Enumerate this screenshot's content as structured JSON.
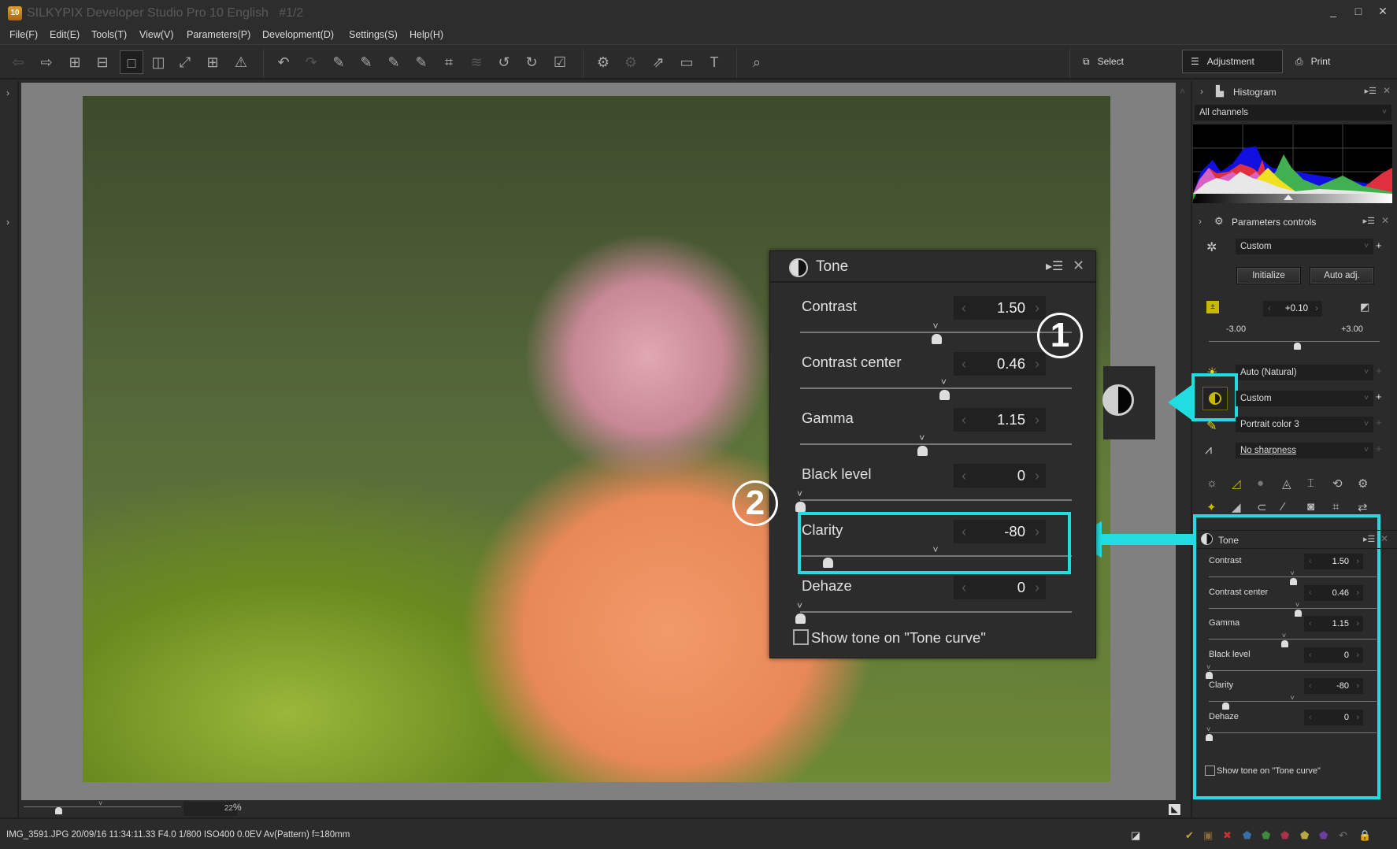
{
  "window": {
    "app_badge": "10",
    "title": "SILKYPIX Developer Studio Pro 10 English",
    "page_indicator": "#1/2",
    "minimize": "_",
    "maximize": "□",
    "close": "✕"
  },
  "menu": [
    "File(F)",
    "Edit(E)",
    "Tools(T)",
    "View(V)",
    "Parameters(P)",
    "Development(D)",
    "Settings(S)",
    "Help(H)"
  ],
  "toolbar": {
    "icons": [
      "previous-image-icon",
      "next-image-icon",
      "thumbnail-grid-icon",
      "filmstrip-icon",
      "single-view-icon",
      "compare-view-icon",
      "fullscreen-icon",
      "fit-view-icon",
      "warning-icon",
      "undo-icon",
      "redo-icon",
      "grey-point-eyedropper-icon",
      "white-balance-eyedropper-icon",
      "black-point-eyedropper-icon",
      "film-eyedropper-icon",
      "transform-icon",
      "layers-icon",
      "rotate-left-icon",
      "rotate-right-icon",
      "mark-checked-icon",
      "save-parameters-icon",
      "apply-parameters-icon",
      "export-icon",
      "display-icon",
      "hammer-icon",
      "loupe-icon"
    ],
    "modes": {
      "select": "Select",
      "adjustment": "Adjustment",
      "print": "Print"
    }
  },
  "canvas": {
    "zoom_value": "22",
    "zoom_unit": "%"
  },
  "status": {
    "info": "IMG_3591.JPG 20/09/16 11:34:11.33 F4.0 1/800 ISO400  0.0EV Av(Pattern) f=180mm",
    "mark_colors": [
      "#c9a437",
      "#8a6b3c",
      "#c83232",
      "#3a6ea8",
      "#3f8a3f",
      "#a8324a",
      "#b8a840",
      "#6a3fa0"
    ]
  },
  "right_panel": {
    "histogram": {
      "title": "Histogram",
      "channel": "All channels"
    },
    "parameters": {
      "title": "Parameters controls",
      "preset": "Custom",
      "initialize": "Initialize",
      "auto_adj": "Auto adj.",
      "exposure_value": "+0.10",
      "exposure_min": "-3.00",
      "exposure_max": "+3.00",
      "exposure_level": 0.517,
      "white_balance": "Auto (Natural)",
      "tone": "Custom",
      "color": "Portrait color 3",
      "sharpness": "No sharpness"
    },
    "tone": {
      "title": "Tone",
      "rows": [
        {
          "label": "Contrast",
          "value": "1.50",
          "level": 0.5,
          "default": 0.5
        },
        {
          "label": "Contrast center",
          "value": "0.46",
          "level": 0.53,
          "default": 0.53
        },
        {
          "label": "Gamma",
          "value": "1.15",
          "level": 0.45,
          "default": 0.45
        },
        {
          "label": "Black level",
          "value": "0",
          "level": 0.0,
          "default": 0.0
        },
        {
          "label": "Clarity",
          "value": "-80",
          "level": 0.1,
          "default": 0.5
        },
        {
          "label": "Dehaze",
          "value": "0",
          "level": 0.0,
          "default": 0.0
        }
      ],
      "show_tone_curve": "Show tone on \"Tone curve\""
    }
  },
  "callouts": {
    "one": "1",
    "two": "2"
  }
}
